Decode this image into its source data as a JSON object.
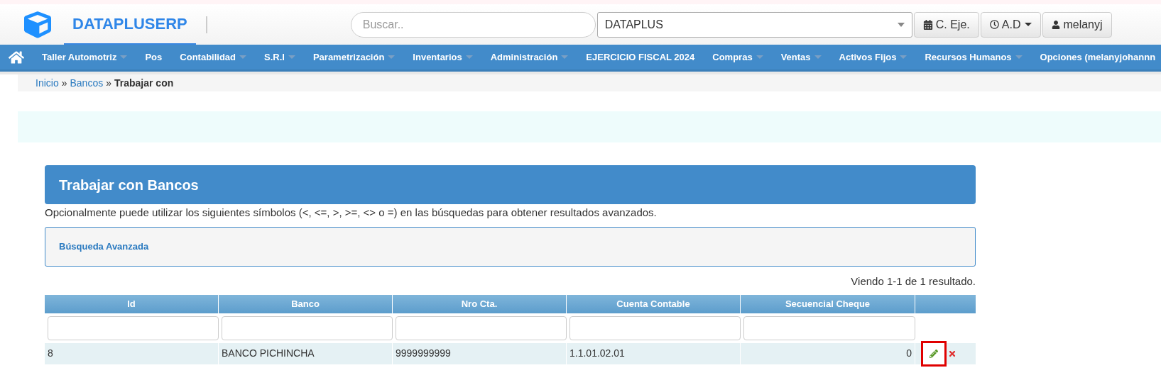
{
  "header": {
    "logo_text": "DATAPLUSERP",
    "search": {
      "placeholder": "Buscar.."
    },
    "company_select": {
      "value": "DATAPLUS"
    },
    "buttons": [
      {
        "kind": "calendar",
        "label": "C. Eje.",
        "has_menu": false
      },
      {
        "kind": "clock",
        "label": "A.D",
        "has_menu": true
      },
      {
        "kind": "user",
        "label": "melanyj",
        "has_menu": false
      }
    ]
  },
  "nav": [
    {
      "label": "Taller Automotriz",
      "has_menu": true
    },
    {
      "label": "Pos",
      "has_menu": false
    },
    {
      "label": "Contabilidad",
      "has_menu": true
    },
    {
      "label": "S.R.I",
      "has_menu": true
    },
    {
      "label": "Parametrización",
      "has_menu": true
    },
    {
      "label": "Inventarios",
      "has_menu": true
    },
    {
      "label": "Administración",
      "has_menu": true
    },
    {
      "label": "EJERCICIO FISCAL 2024",
      "has_menu": false
    },
    {
      "label": "Compras",
      "has_menu": true
    },
    {
      "label": "Ventas",
      "has_menu": true
    },
    {
      "label": "Activos Fijos",
      "has_menu": true
    },
    {
      "label": "Recursos Humanos",
      "has_menu": true
    },
    {
      "label": "Opciones (melanyjohannn",
      "has_menu": false
    }
  ],
  "breadcrumb": [
    {
      "label": "Inicio",
      "link": true
    },
    {
      "label": "Bancos",
      "link": true
    },
    {
      "label": "Trabajar con",
      "link": false
    }
  ],
  "breadcrumb_separator": "»",
  "panel": {
    "title": "Trabajar con Bancos",
    "hint": "Opcionalmente puede utilizar los siguientes símbolos (<, <=, >, >=, <> o =) en las búsquedas para obtener resultados avanzados.",
    "advanced_search": "Búsqueda Avanzada"
  },
  "summary": "Viendo 1-1 de 1 resultado.",
  "table": {
    "columns": [
      "Id",
      "Banco",
      "Nro Cta.",
      "Cuenta Contable",
      "Secuencial Cheque"
    ],
    "rows": [
      {
        "cells": [
          "8",
          "BANCO PICHINCHA",
          "9999999999",
          "1.1.01.02.01",
          "0"
        ],
        "edit_highlighted": true
      }
    ]
  }
}
